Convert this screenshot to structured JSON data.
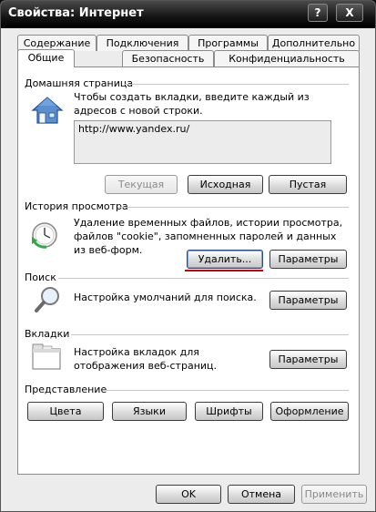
{
  "window": {
    "title": "Свойства: Интернет",
    "help_glyph": "?",
    "close_glyph": "X"
  },
  "tabs_row1": [
    "Содержание",
    "Подключения",
    "Программы",
    "Дополнительно"
  ],
  "tabs_row2": [
    "Общие",
    "Безопасность",
    "Конфиденциальность"
  ],
  "home": {
    "label": "Домашняя страница",
    "description": "Чтобы создать вкладки, введите каждый из адресов с новой строки.",
    "url": "http://www.yandex.ru/",
    "btn_current": "Текущая",
    "btn_default": "Исходная",
    "btn_blank": "Пустая",
    "icon": "home-icon"
  },
  "history": {
    "label": "История просмотра",
    "description": "Удаление временных файлов, истории просмотра, файлов \"cookie\", запомненных паролей и данных из веб-форм.",
    "btn_delete": "Удалить...",
    "btn_params": "Параметры",
    "icon": "history-clock-icon"
  },
  "search": {
    "label": "Поиск",
    "description": "Настройка умолчаний для поиска.",
    "btn_params": "Параметры",
    "icon": "magnifier-icon"
  },
  "tabs_section": {
    "label": "Вкладки",
    "description": "Настройка вкладок для отображения веб-страниц.",
    "btn_params": "Параметры",
    "icon": "tabs-window-icon"
  },
  "appearance": {
    "label": "Представление",
    "btn_colors": "Цвета",
    "btn_languages": "Языки",
    "btn_fonts": "Шрифты",
    "btn_design": "Оформление"
  },
  "footer": {
    "ok": "OK",
    "cancel": "Отмена",
    "apply": "Применить"
  },
  "colors": {
    "titlebar": "#000000",
    "dialog_bg": "#ececec",
    "panel_bg": "#ffffff",
    "highlight_underline": "#d40000"
  }
}
